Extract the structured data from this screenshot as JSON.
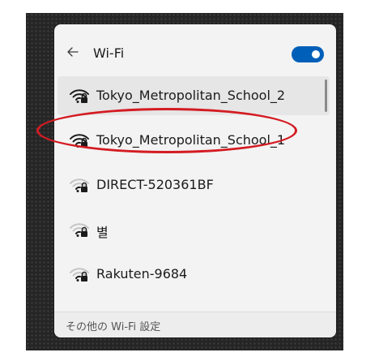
{
  "panel": {
    "title": "Wi-Fi",
    "back_icon": "arrow-left-icon",
    "toggle_on": true,
    "accent_color": "#005fb8"
  },
  "networks": [
    {
      "name": "Tokyo_Metropolitan_School_2",
      "secured": true,
      "signal": "strong"
    },
    {
      "name": "Tokyo_Metropolitan_School_1",
      "secured": true,
      "signal": "strong"
    },
    {
      "name": "DIRECT-520361BF",
      "secured": true,
      "signal": "weak"
    },
    {
      "name": "별",
      "secured": true,
      "signal": "weak"
    },
    {
      "name": "Rakuten-9684",
      "secured": true,
      "signal": "weak"
    }
  ],
  "footer": {
    "more_settings": "その他の Wi-Fi 設定"
  },
  "annotation_color": "#d41b22"
}
